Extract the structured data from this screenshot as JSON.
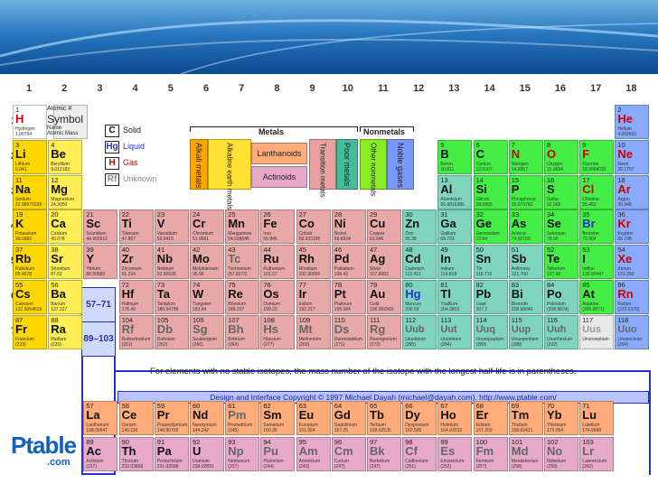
{
  "groups": [
    "1",
    "2",
    "3",
    "4",
    "5",
    "6",
    "7",
    "8",
    "9",
    "10",
    "11",
    "12",
    "13",
    "14",
    "15",
    "16",
    "17",
    "18"
  ],
  "periods": [
    "1",
    "2",
    "3",
    "4",
    "5",
    "6",
    "7"
  ],
  "key": {
    "number": "Atomic #",
    "symbol": "Symbol",
    "name": "Name",
    "mass": "Atomic Mass"
  },
  "states": {
    "solid": "Solid",
    "liquid": "Liquid",
    "gas": "Gas",
    "unknown": "Unknown",
    "solid_sym": "C",
    "liquid_sym": "Hg",
    "gas_sym": "H",
    "unknown_sym": "Rf"
  },
  "categories": {
    "metals": "Metals",
    "nonmetals": "Nonmetals",
    "alkali": "Alkali metals",
    "alkaline": "Alkaline earth metals",
    "lanthanoids": "Lanthanoids",
    "actinoids": "Actinoids",
    "transition": "Transition metals",
    "poor": "Poor metals",
    "other_nonmetals": "Other nonmetals",
    "noble": "Noble gases"
  },
  "placeholders": {
    "lanthanides": "57–71",
    "actinides": "89–103"
  },
  "note": "For elements with no stable isotopes, the mass number of the isotope with the longest half-life is in parentheses.",
  "copyright": "Design and Interface Copyright © 1997 Michael Dayah (michael@dayah.com). http://www.ptable.com/",
  "logo": {
    "main": "Ptable",
    "sub": ".com"
  },
  "colors": {
    "alkali": "#ff6666",
    "alkaline": "#ffdead",
    "transition": "#ffc0c0",
    "poor": "#cccccc",
    "metalloid": "#cccc99",
    "nonmetal": "#a0ffa0",
    "halogen": "#ffff99",
    "noble": "#c0ffff",
    "lanthanoid": "#ffbfff",
    "actinoid": "#ff99cc"
  },
  "elements": [
    [
      "1",
      "H",
      "Hydrogen",
      "1.00794",
      "1",
      "1",
      "hyd"
    ],
    [
      "2",
      "He",
      "Helium",
      "4.002602",
      "1",
      "18",
      "nob"
    ],
    [
      "3",
      "Li",
      "Lithium",
      "6.941",
      "2",
      "1",
      "alk"
    ],
    [
      "4",
      "Be",
      "Beryllium",
      "9.012182",
      "2",
      "2",
      "ale"
    ],
    [
      "5",
      "B",
      "Boron",
      "10.811",
      "2",
      "13",
      "oth"
    ],
    [
      "6",
      "C",
      "Carbon",
      "12.0107",
      "2",
      "14",
      "oth"
    ],
    [
      "7",
      "N",
      "Nitrogen",
      "14.0067",
      "2",
      "15",
      "oth"
    ],
    [
      "8",
      "O",
      "Oxygen",
      "15.9994",
      "2",
      "16",
      "oth"
    ],
    [
      "9",
      "F",
      "Fluorine",
      "18.9984032",
      "2",
      "17",
      "oth"
    ],
    [
      "10",
      "Ne",
      "Neon",
      "20.1797",
      "2",
      "18",
      "nob"
    ],
    [
      "11",
      "Na",
      "Sodium",
      "22.98976928",
      "3",
      "1",
      "alk"
    ],
    [
      "12",
      "Mg",
      "Magnesium",
      "24.3050",
      "3",
      "2",
      "ale"
    ],
    [
      "13",
      "Al",
      "Aluminium",
      "26.9815386",
      "3",
      "13",
      "poo"
    ],
    [
      "14",
      "Si",
      "Silicon",
      "28.0855",
      "3",
      "14",
      "oth"
    ],
    [
      "15",
      "P",
      "Phosphorus",
      "30.973762",
      "3",
      "15",
      "oth"
    ],
    [
      "16",
      "S",
      "Sulfur",
      "32.065",
      "3",
      "16",
      "oth"
    ],
    [
      "17",
      "Cl",
      "Chlorine",
      "35.453",
      "3",
      "17",
      "oth"
    ],
    [
      "18",
      "Ar",
      "Argon",
      "39.948",
      "3",
      "18",
      "nob"
    ],
    [
      "19",
      "K",
      "Potassium",
      "39.0983",
      "4",
      "1",
      "alk"
    ],
    [
      "20",
      "Ca",
      "Calcium",
      "40.078",
      "4",
      "2",
      "ale"
    ],
    [
      "21",
      "Sc",
      "Scandium",
      "44.955912",
      "4",
      "3",
      "tra"
    ],
    [
      "22",
      "Ti",
      "Titanium",
      "47.867",
      "4",
      "4",
      "tra"
    ],
    [
      "23",
      "V",
      "Vanadium",
      "50.9415",
      "4",
      "5",
      "tra"
    ],
    [
      "24",
      "Cr",
      "Chromium",
      "51.9961",
      "4",
      "6",
      "tra"
    ],
    [
      "25",
      "Mn",
      "Manganese",
      "54.938045",
      "4",
      "7",
      "tra"
    ],
    [
      "26",
      "Fe",
      "Iron",
      "55.845",
      "4",
      "8",
      "tra"
    ],
    [
      "27",
      "Co",
      "Cobalt",
      "58.933195",
      "4",
      "9",
      "tra"
    ],
    [
      "28",
      "Ni",
      "Nickel",
      "58.6934",
      "4",
      "10",
      "tra"
    ],
    [
      "29",
      "Cu",
      "Copper",
      "63.546",
      "4",
      "11",
      "tra"
    ],
    [
      "30",
      "Zn",
      "Zinc",
      "65.38",
      "4",
      "12",
      "poo"
    ],
    [
      "31",
      "Ga",
      "Gallium",
      "69.723",
      "4",
      "13",
      "poo"
    ],
    [
      "32",
      "Ge",
      "Germanium",
      "72.64",
      "4",
      "14",
      "oth"
    ],
    [
      "33",
      "As",
      "Arsenic",
      "74.92160",
      "4",
      "15",
      "oth"
    ],
    [
      "34",
      "Se",
      "Selenium",
      "78.96",
      "4",
      "16",
      "oth"
    ],
    [
      "35",
      "Br",
      "Bromine",
      "79.904",
      "4",
      "17",
      "oth"
    ],
    [
      "36",
      "Kr",
      "Krypton",
      "83.798",
      "4",
      "18",
      "nob"
    ],
    [
      "37",
      "Rb",
      "Rubidium",
      "85.4678",
      "5",
      "1",
      "alk"
    ],
    [
      "38",
      "Sr",
      "Strontium",
      "87.62",
      "5",
      "2",
      "ale"
    ],
    [
      "39",
      "Y",
      "Yttrium",
      "88.90585",
      "5",
      "3",
      "tra"
    ],
    [
      "40",
      "Zr",
      "Zirconium",
      "91.224",
      "5",
      "4",
      "tra"
    ],
    [
      "41",
      "Nb",
      "Niobium",
      "92.90638",
      "5",
      "5",
      "tra"
    ],
    [
      "42",
      "Mo",
      "Molybdenum",
      "95.96",
      "5",
      "6",
      "tra"
    ],
    [
      "43",
      "Tc",
      "Technetium",
      "(97.9072)",
      "5",
      "7",
      "tra"
    ],
    [
      "44",
      "Ru",
      "Ruthenium",
      "101.07",
      "5",
      "8",
      "tra"
    ],
    [
      "45",
      "Rh",
      "Rhodium",
      "102.90550",
      "5",
      "9",
      "tra"
    ],
    [
      "46",
      "Pd",
      "Palladium",
      "106.42",
      "5",
      "10",
      "tra"
    ],
    [
      "47",
      "Ag",
      "Silver",
      "107.8682",
      "5",
      "11",
      "tra"
    ],
    [
      "48",
      "Cd",
      "Cadmium",
      "112.411",
      "5",
      "12",
      "poo"
    ],
    [
      "49",
      "In",
      "Indium",
      "114.818",
      "5",
      "13",
      "poo"
    ],
    [
      "50",
      "Sn",
      "Tin",
      "118.710",
      "5",
      "14",
      "poo"
    ],
    [
      "51",
      "Sb",
      "Antimony",
      "121.760",
      "5",
      "15",
      "poo"
    ],
    [
      "52",
      "Te",
      "Tellurium",
      "127.60",
      "5",
      "16",
      "oth"
    ],
    [
      "53",
      "I",
      "Iodine",
      "126.90447",
      "5",
      "17",
      "oth"
    ],
    [
      "54",
      "Xe",
      "Xenon",
      "131.293",
      "5",
      "18",
      "nob"
    ],
    [
      "55",
      "Cs",
      "Caesium",
      "132.9054519",
      "6",
      "1",
      "alk"
    ],
    [
      "56",
      "Ba",
      "Barium",
      "137.327",
      "6",
      "2",
      "ale"
    ],
    [
      "72",
      "Hf",
      "Hafnium",
      "178.49",
      "6",
      "4",
      "tra"
    ],
    [
      "73",
      "Ta",
      "Tantalum",
      "180.94788",
      "6",
      "5",
      "tra"
    ],
    [
      "74",
      "W",
      "Tungsten",
      "183.84",
      "6",
      "6",
      "tra"
    ],
    [
      "75",
      "Re",
      "Rhenium",
      "186.207",
      "6",
      "7",
      "tra"
    ],
    [
      "76",
      "Os",
      "Osmium",
      "190.23",
      "6",
      "8",
      "tra"
    ],
    [
      "77",
      "Ir",
      "Iridium",
      "192.217",
      "6",
      "9",
      "tra"
    ],
    [
      "78",
      "Pt",
      "Platinum",
      "195.084",
      "6",
      "10",
      "tra"
    ],
    [
      "79",
      "Au",
      "Gold",
      "196.966569",
      "6",
      "11",
      "tra"
    ],
    [
      "80",
      "Hg",
      "Mercury",
      "200.59",
      "6",
      "12",
      "poo"
    ],
    [
      "81",
      "Tl",
      "Thallium",
      "204.3833",
      "6",
      "13",
      "poo"
    ],
    [
      "82",
      "Pb",
      "Lead",
      "207.2",
      "6",
      "14",
      "poo"
    ],
    [
      "83",
      "Bi",
      "Bismuth",
      "208.98040",
      "6",
      "15",
      "poo"
    ],
    [
      "84",
      "Po",
      "Polonium",
      "(208.9824)",
      "6",
      "16",
      "poo"
    ],
    [
      "85",
      "At",
      "Astatine",
      "(209.9871)",
      "6",
      "17",
      "oth"
    ],
    [
      "86",
      "Rn",
      "Radon",
      "(222.0176)",
      "6",
      "18",
      "nob"
    ],
    [
      "87",
      "Fr",
      "Francium",
      "(223)",
      "7",
      "1",
      "alk"
    ],
    [
      "88",
      "Ra",
      "Radium",
      "(226)",
      "7",
      "2",
      "ale"
    ],
    [
      "104",
      "Rf",
      "Rutherfordium",
      "(261)",
      "7",
      "4",
      "tra"
    ],
    [
      "105",
      "Db",
      "Dubnium",
      "(262)",
      "7",
      "5",
      "tra"
    ],
    [
      "106",
      "Sg",
      "Seaborgium",
      "(266)",
      "7",
      "6",
      "tra"
    ],
    [
      "107",
      "Bh",
      "Bohrium",
      "(264)",
      "7",
      "7",
      "tra"
    ],
    [
      "108",
      "Hs",
      "Hassium",
      "(277)",
      "7",
      "8",
      "tra"
    ],
    [
      "109",
      "Mt",
      "Meitnerium",
      "(268)",
      "7",
      "9",
      "tra"
    ],
    [
      "110",
      "Ds",
      "Darmstadtium",
      "(271)",
      "7",
      "10",
      "tra"
    ],
    [
      "111",
      "Rg",
      "Roentgenium",
      "(272)",
      "7",
      "11",
      "tra"
    ],
    [
      "112",
      "Uub",
      "Ununbium",
      "(285)",
      "7",
      "12",
      "poo"
    ],
    [
      "113",
      "Uut",
      "Ununtrium",
      "(284)",
      "7",
      "13",
      "poo"
    ],
    [
      "114",
      "Uuq",
      "Ununquadium",
      "(289)",
      "7",
      "14",
      "poo"
    ],
    [
      "115",
      "Uup",
      "Ununpentium",
      "(288)",
      "7",
      "15",
      "poo"
    ],
    [
      "116",
      "Uuh",
      "Ununhexium",
      "(292)",
      "7",
      "16",
      "poo"
    ],
    [
      "117",
      "Uus",
      "Ununseptium",
      "",
      "7",
      "17",
      "unk"
    ],
    [
      "118",
      "Uuo",
      "Ununoctium",
      "(294)",
      "7",
      "18",
      "nob"
    ],
    [
      "57",
      "La",
      "Lanthanum",
      "138.90547",
      "9",
      "3",
      "lan"
    ],
    [
      "58",
      "Ce",
      "Cerium",
      "140.116",
      "9",
      "4",
      "lan"
    ],
    [
      "59",
      "Pr",
      "Praseodymium",
      "140.90765",
      "9",
      "5",
      "lan"
    ],
    [
      "60",
      "Nd",
      "Neodymium",
      "144.242",
      "9",
      "6",
      "lan"
    ],
    [
      "61",
      "Pm",
      "Promethium",
      "(145)",
      "9",
      "7",
      "lan"
    ],
    [
      "62",
      "Sm",
      "Samarium",
      "150.36",
      "9",
      "8",
      "lan"
    ],
    [
      "63",
      "Eu",
      "Europium",
      "151.964",
      "9",
      "9",
      "lan"
    ],
    [
      "64",
      "Gd",
      "Gadolinium",
      "157.25",
      "9",
      "10",
      "lan"
    ],
    [
      "65",
      "Tb",
      "Terbium",
      "158.92535",
      "9",
      "11",
      "lan"
    ],
    [
      "66",
      "Dy",
      "Dysprosium",
      "162.500",
      "9",
      "12",
      "lan"
    ],
    [
      "67",
      "Ho",
      "Holmium",
      "164.93032",
      "9",
      "13",
      "lan"
    ],
    [
      "68",
      "Er",
      "Erbium",
      "167.259",
      "9",
      "14",
      "lan"
    ],
    [
      "69",
      "Tm",
      "Thulium",
      "168.93421",
      "9",
      "15",
      "lan"
    ],
    [
      "70",
      "Yb",
      "Ytterbium",
      "173.054",
      "9",
      "16",
      "lan"
    ],
    [
      "71",
      "Lu",
      "Lutetium",
      "174.9668",
      "9",
      "17",
      "lan"
    ],
    [
      "89",
      "Ac",
      "Actinium",
      "(227)",
      "10",
      "3",
      "act"
    ],
    [
      "90",
      "Th",
      "Thorium",
      "232.03806",
      "10",
      "4",
      "act"
    ],
    [
      "91",
      "Pa",
      "Protactinium",
      "231.03588",
      "10",
      "5",
      "act"
    ],
    [
      "92",
      "U",
      "Uranium",
      "238.02891",
      "10",
      "6",
      "act"
    ],
    [
      "93",
      "Np",
      "Neptunium",
      "(237)",
      "10",
      "7",
      "act"
    ],
    [
      "94",
      "Pu",
      "Plutonium",
      "(244)",
      "10",
      "8",
      "act"
    ],
    [
      "95",
      "Am",
      "Americium",
      "(243)",
      "10",
      "9",
      "act"
    ],
    [
      "96",
      "Cm",
      "Curium",
      "(247)",
      "10",
      "10",
      "act"
    ],
    [
      "97",
      "Bk",
      "Berkelium",
      "(247)",
      "10",
      "11",
      "act"
    ],
    [
      "98",
      "Cf",
      "Californium",
      "(251)",
      "10",
      "12",
      "act"
    ],
    [
      "99",
      "Es",
      "Einsteinium",
      "(252)",
      "10",
      "13",
      "act"
    ],
    [
      "100",
      "Fm",
      "Fermium",
      "(257)",
      "10",
      "14",
      "act"
    ],
    [
      "101",
      "Md",
      "Mendelevium",
      "(258)",
      "10",
      "15",
      "act"
    ],
    [
      "102",
      "No",
      "Nobelium",
      "(259)",
      "10",
      "16",
      "act"
    ],
    [
      "103",
      "Lr",
      "Lawrencium",
      "(262)",
      "10",
      "17",
      "act"
    ]
  ]
}
